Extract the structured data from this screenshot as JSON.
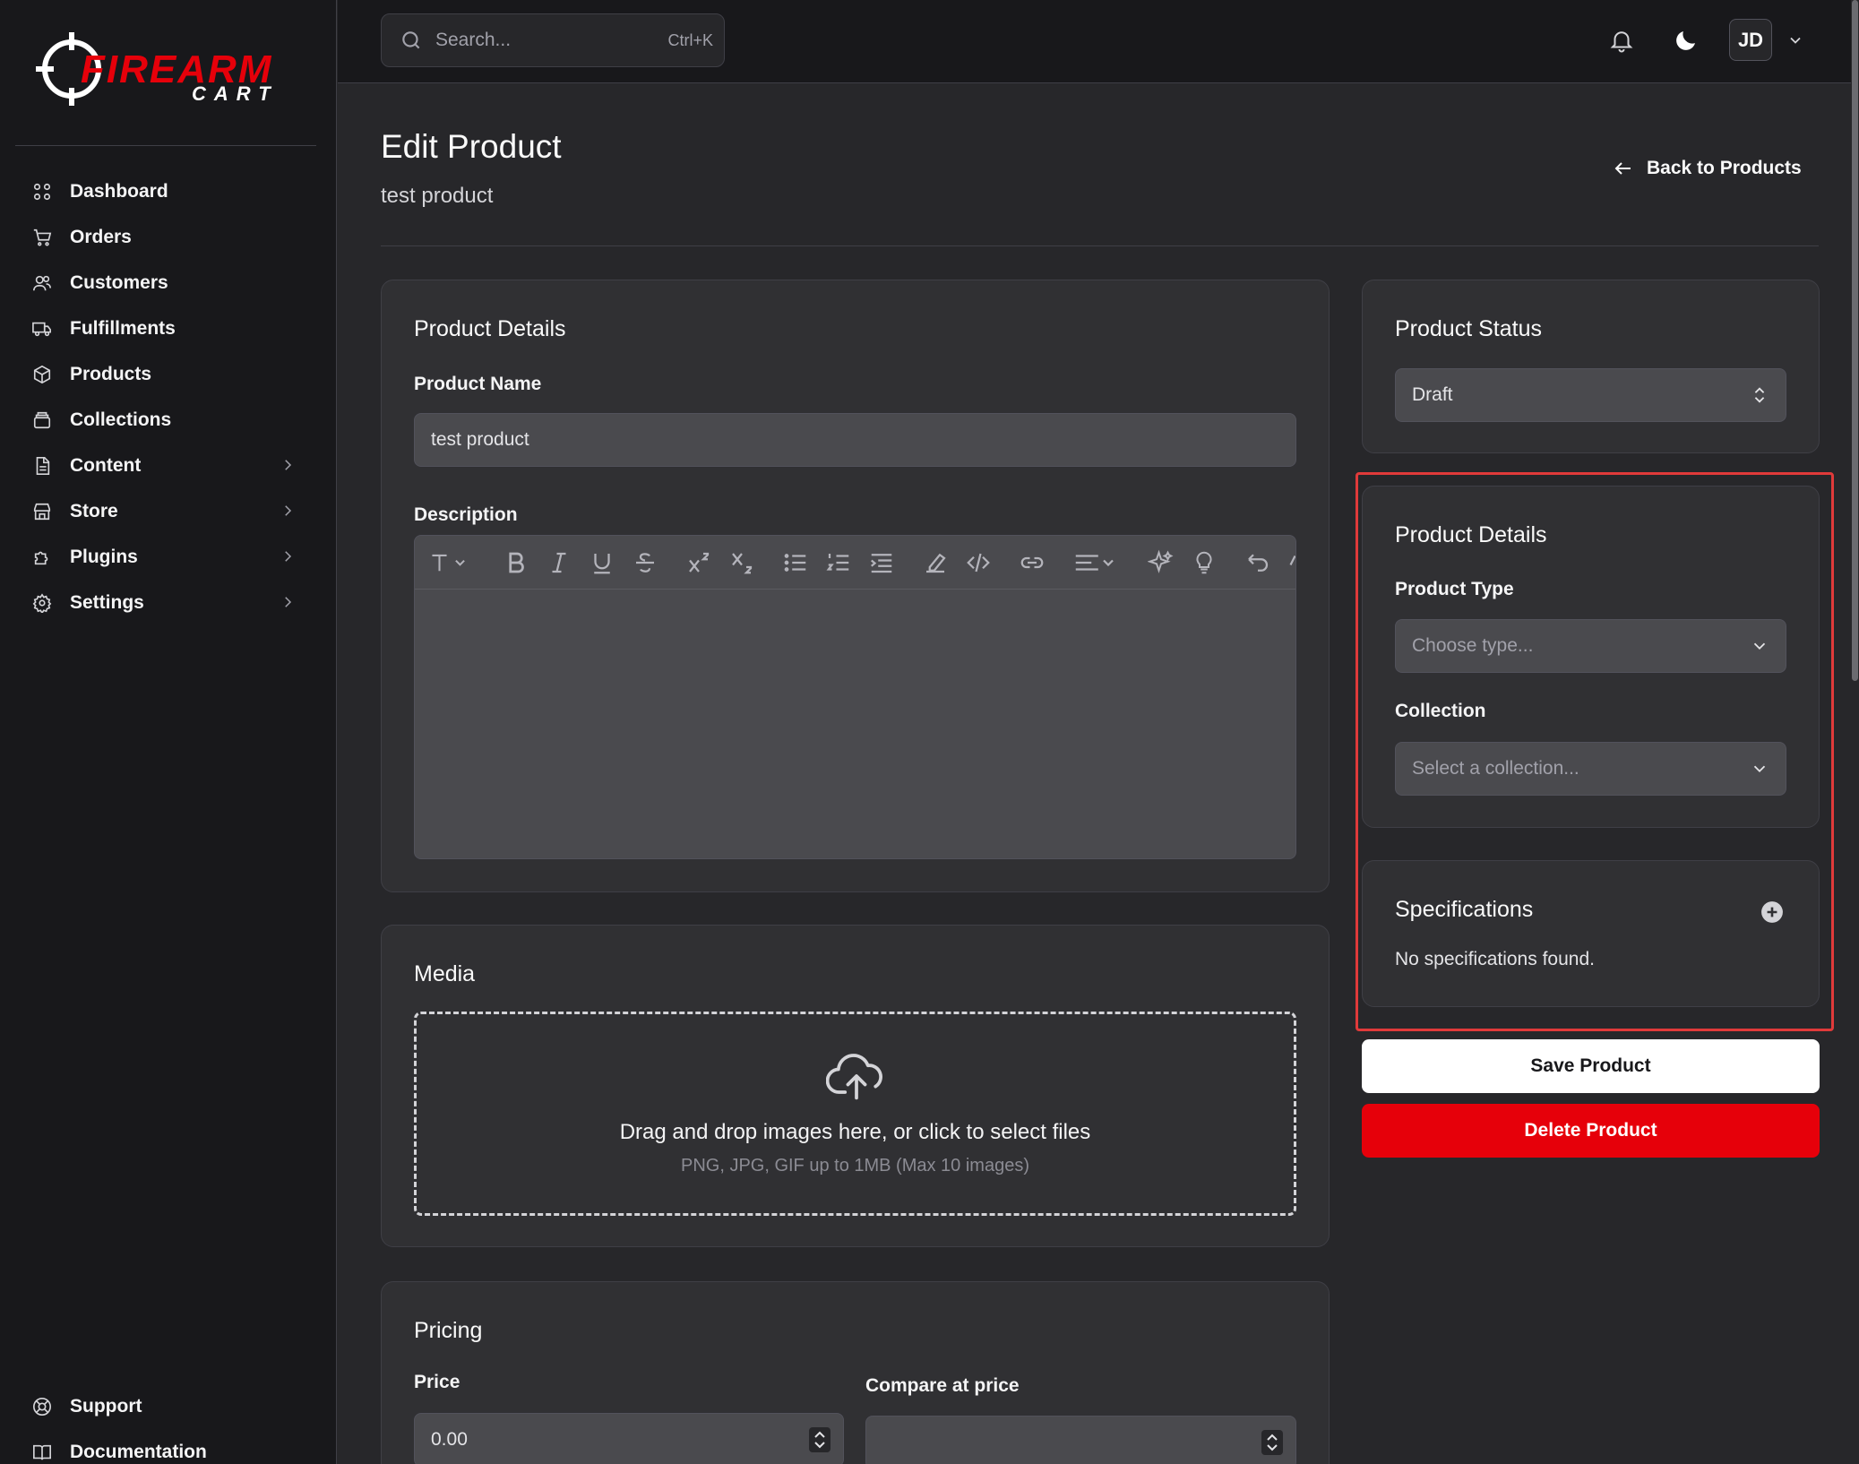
{
  "app": {
    "logo_text_top": "FIREARM",
    "logo_text_bottom": "CART",
    "brand_color": "#e6000a"
  },
  "sidebar": {
    "items": [
      {
        "label": "Dashboard",
        "icon": "grid-icon",
        "has_children": false
      },
      {
        "label": "Orders",
        "icon": "cart-icon",
        "has_children": false
      },
      {
        "label": "Customers",
        "icon": "users-icon",
        "has_children": false
      },
      {
        "label": "Fulfillments",
        "icon": "truck-icon",
        "has_children": false
      },
      {
        "label": "Products",
        "icon": "box-icon",
        "has_children": false
      },
      {
        "label": "Collections",
        "icon": "archive-icon",
        "has_children": false
      },
      {
        "label": "Content",
        "icon": "file-icon",
        "has_children": true
      },
      {
        "label": "Store",
        "icon": "store-icon",
        "has_children": true
      },
      {
        "label": "Plugins",
        "icon": "puzzle-icon",
        "has_children": true
      },
      {
        "label": "Settings",
        "icon": "gear-icon",
        "has_children": true
      }
    ],
    "bottom_items": [
      {
        "label": "Support",
        "icon": "lifebuoy-icon"
      },
      {
        "label": "Documentation",
        "icon": "book-icon"
      }
    ]
  },
  "header": {
    "search_placeholder": "Search...",
    "search_shortcut": "Ctrl+K",
    "avatar_initials": "JD"
  },
  "page": {
    "title": "Edit Product",
    "subtitle": "test product",
    "back_label": "Back to Products"
  },
  "product_details": {
    "title": "Product Details",
    "name_label": "Product Name",
    "name_value": "test product",
    "description_label": "Description",
    "description_value": ""
  },
  "media": {
    "title": "Media",
    "drop_text": "Drag and drop images here, or click to select files",
    "drop_hint": "PNG, JPG, GIF up to 1MB (Max 10 images)"
  },
  "pricing": {
    "title": "Pricing",
    "price_label": "Price",
    "price_value": "0.00",
    "compare_label": "Compare at price",
    "compare_value": ""
  },
  "status": {
    "title": "Product Status",
    "value": "Draft"
  },
  "organization": {
    "title": "Product Details",
    "type_label": "Product Type",
    "type_placeholder": "Choose type...",
    "collection_label": "Collection",
    "collection_placeholder": "Select a collection..."
  },
  "specifications": {
    "title": "Specifications",
    "empty_text": "No specifications found."
  },
  "actions": {
    "save_label": "Save Product",
    "delete_label": "Delete Product"
  },
  "colors": {
    "highlight": "#e03a3a",
    "delete": "#e6000a"
  }
}
